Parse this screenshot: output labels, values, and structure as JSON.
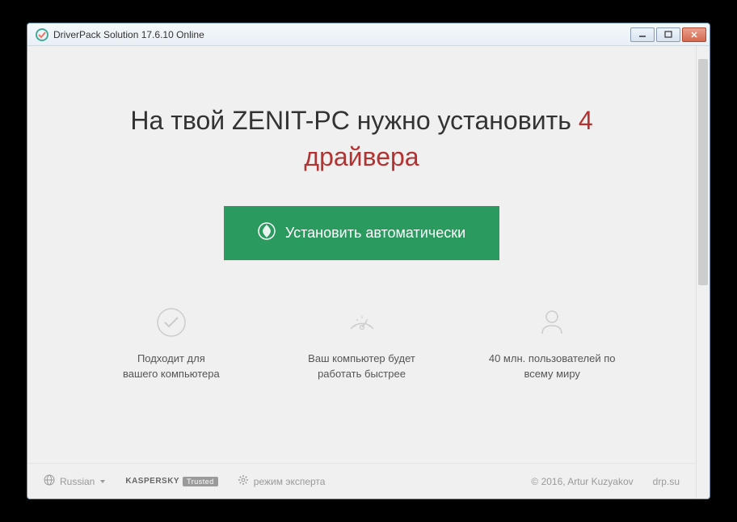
{
  "window": {
    "title": "DriverPack Solution 17.6.10 Online"
  },
  "headline": {
    "prefix": "На твой ZENIT-PC нужно установить ",
    "count": "4",
    "suffix": "драйвера"
  },
  "install_button": {
    "label": "Установить автоматически"
  },
  "features": [
    {
      "line1": "Подходит для",
      "line2": "вашего компьютера"
    },
    {
      "line1": "Ваш компьютер будет",
      "line2": "работать быстрее"
    },
    {
      "line1": "40 млн. пользователей по",
      "line2": "всему миру"
    }
  ],
  "footer": {
    "language": "Russian",
    "kaspersky": "KASPERSKY",
    "trusted": "Trusted",
    "expert_mode": "режим эксперта",
    "copyright": "© 2016, Artur Kuzyakov",
    "site": "drp.su"
  }
}
